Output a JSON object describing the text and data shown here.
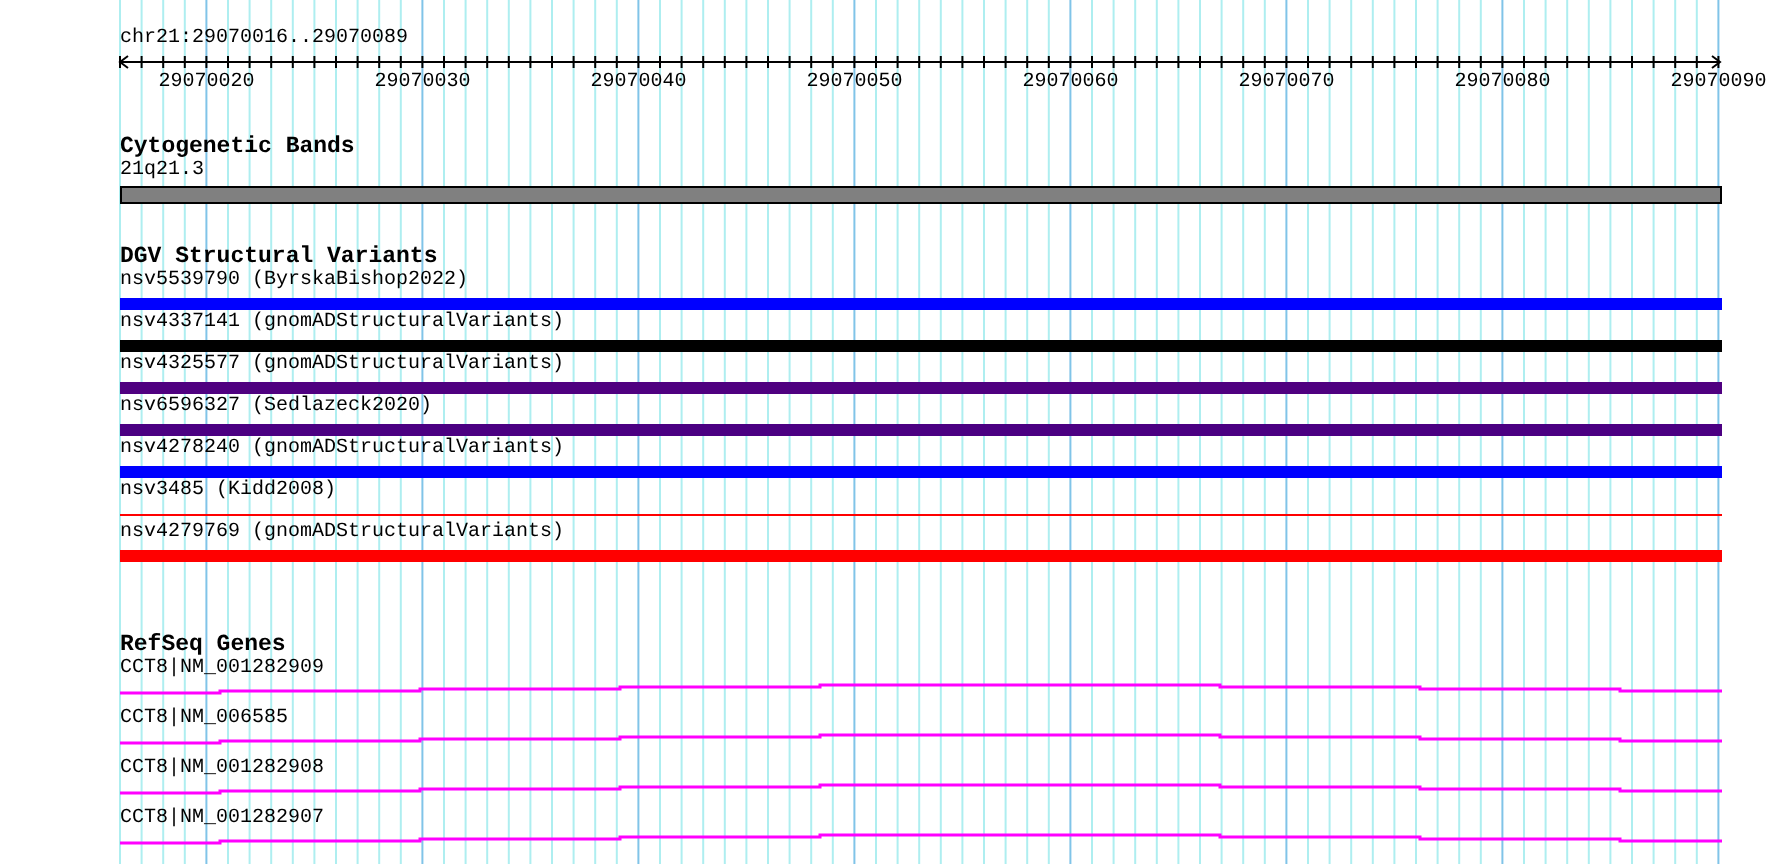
{
  "ruler": {
    "location": "chr21:29070016..29070089",
    "tick_labels": [
      "29070020",
      "29070030",
      "29070040",
      "29070050",
      "29070060",
      "29070070",
      "29070080",
      "29070090"
    ]
  },
  "tracks": [
    {
      "kind": "bands",
      "title": "Cytogenetic Bands",
      "features": [
        {
          "label": "21q21.3",
          "color": "#808080"
        }
      ]
    },
    {
      "kind": "variants",
      "title": "DGV Structural Variants",
      "features": [
        {
          "label": "nsv5539790 (ByrskaBishop2022)",
          "color": "#0000ff",
          "kind": "bar"
        },
        {
          "label": "nsv4337141 (gnomADStructuralVariants)",
          "color": "#000000",
          "kind": "bar"
        },
        {
          "label": "nsv4325577 (gnomADStructuralVariants)",
          "color": "#4f0080",
          "kind": "bar"
        },
        {
          "label": "nsv6596327 (Sedlazeck2020)",
          "color": "#4b0082",
          "kind": "bar"
        },
        {
          "label": "nsv4278240 (gnomADStructuralVariants)",
          "color": "#0000ff",
          "kind": "bar"
        },
        {
          "label": "nsv3485 (Kidd2008)",
          "color": "#ff0000",
          "kind": "line"
        },
        {
          "label": "nsv4279769 (gnomADStructuralVariants)",
          "color": "#ff0000",
          "kind": "bar"
        }
      ]
    },
    {
      "kind": "genes",
      "title": "RefSeq Genes",
      "features": [
        {
          "label": "CCT8|NM_001282909",
          "color": "#ff00ff"
        },
        {
          "label": "CCT8|NM_006585",
          "color": "#ff00ff"
        },
        {
          "label": "CCT8|NM_001282908",
          "color": "#ff00ff"
        },
        {
          "label": "CCT8|NM_001282907",
          "color": "#ff00ff"
        }
      ]
    }
  ]
}
